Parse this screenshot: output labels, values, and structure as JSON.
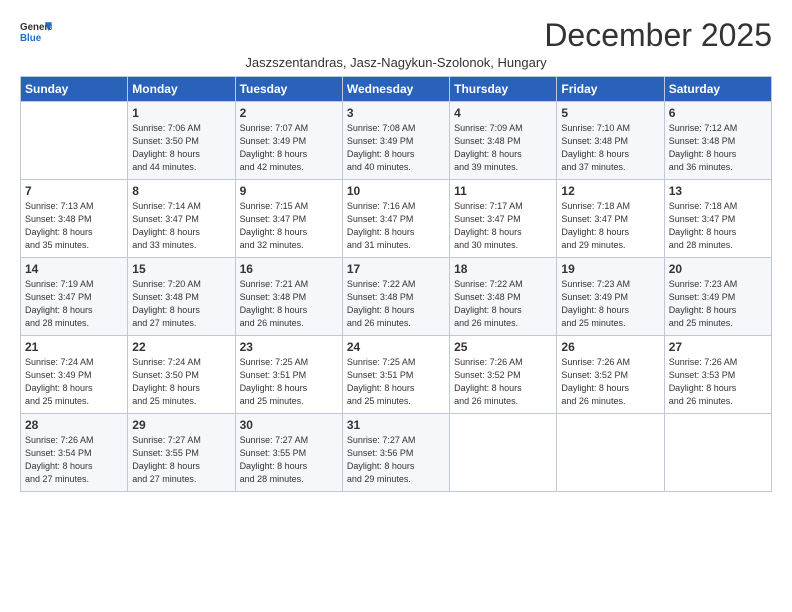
{
  "logo": {
    "line1": "General",
    "line2": "Blue"
  },
  "title": "December 2025",
  "subtitle": "Jaszszentandras, Jasz-Nagykun-Szolonok, Hungary",
  "header_days": [
    "Sunday",
    "Monday",
    "Tuesday",
    "Wednesday",
    "Thursday",
    "Friday",
    "Saturday"
  ],
  "weeks": [
    [
      {
        "num": "",
        "info": ""
      },
      {
        "num": "1",
        "info": "Sunrise: 7:06 AM\nSunset: 3:50 PM\nDaylight: 8 hours\nand 44 minutes."
      },
      {
        "num": "2",
        "info": "Sunrise: 7:07 AM\nSunset: 3:49 PM\nDaylight: 8 hours\nand 42 minutes."
      },
      {
        "num": "3",
        "info": "Sunrise: 7:08 AM\nSunset: 3:49 PM\nDaylight: 8 hours\nand 40 minutes."
      },
      {
        "num": "4",
        "info": "Sunrise: 7:09 AM\nSunset: 3:48 PM\nDaylight: 8 hours\nand 39 minutes."
      },
      {
        "num": "5",
        "info": "Sunrise: 7:10 AM\nSunset: 3:48 PM\nDaylight: 8 hours\nand 37 minutes."
      },
      {
        "num": "6",
        "info": "Sunrise: 7:12 AM\nSunset: 3:48 PM\nDaylight: 8 hours\nand 36 minutes."
      }
    ],
    [
      {
        "num": "7",
        "info": "Sunrise: 7:13 AM\nSunset: 3:48 PM\nDaylight: 8 hours\nand 35 minutes."
      },
      {
        "num": "8",
        "info": "Sunrise: 7:14 AM\nSunset: 3:47 PM\nDaylight: 8 hours\nand 33 minutes."
      },
      {
        "num": "9",
        "info": "Sunrise: 7:15 AM\nSunset: 3:47 PM\nDaylight: 8 hours\nand 32 minutes."
      },
      {
        "num": "10",
        "info": "Sunrise: 7:16 AM\nSunset: 3:47 PM\nDaylight: 8 hours\nand 31 minutes."
      },
      {
        "num": "11",
        "info": "Sunrise: 7:17 AM\nSunset: 3:47 PM\nDaylight: 8 hours\nand 30 minutes."
      },
      {
        "num": "12",
        "info": "Sunrise: 7:18 AM\nSunset: 3:47 PM\nDaylight: 8 hours\nand 29 minutes."
      },
      {
        "num": "13",
        "info": "Sunrise: 7:18 AM\nSunset: 3:47 PM\nDaylight: 8 hours\nand 28 minutes."
      }
    ],
    [
      {
        "num": "14",
        "info": "Sunrise: 7:19 AM\nSunset: 3:47 PM\nDaylight: 8 hours\nand 28 minutes."
      },
      {
        "num": "15",
        "info": "Sunrise: 7:20 AM\nSunset: 3:48 PM\nDaylight: 8 hours\nand 27 minutes."
      },
      {
        "num": "16",
        "info": "Sunrise: 7:21 AM\nSunset: 3:48 PM\nDaylight: 8 hours\nand 26 minutes."
      },
      {
        "num": "17",
        "info": "Sunrise: 7:22 AM\nSunset: 3:48 PM\nDaylight: 8 hours\nand 26 minutes."
      },
      {
        "num": "18",
        "info": "Sunrise: 7:22 AM\nSunset: 3:48 PM\nDaylight: 8 hours\nand 26 minutes."
      },
      {
        "num": "19",
        "info": "Sunrise: 7:23 AM\nSunset: 3:49 PM\nDaylight: 8 hours\nand 25 minutes."
      },
      {
        "num": "20",
        "info": "Sunrise: 7:23 AM\nSunset: 3:49 PM\nDaylight: 8 hours\nand 25 minutes."
      }
    ],
    [
      {
        "num": "21",
        "info": "Sunrise: 7:24 AM\nSunset: 3:49 PM\nDaylight: 8 hours\nand 25 minutes."
      },
      {
        "num": "22",
        "info": "Sunrise: 7:24 AM\nSunset: 3:50 PM\nDaylight: 8 hours\nand 25 minutes."
      },
      {
        "num": "23",
        "info": "Sunrise: 7:25 AM\nSunset: 3:51 PM\nDaylight: 8 hours\nand 25 minutes."
      },
      {
        "num": "24",
        "info": "Sunrise: 7:25 AM\nSunset: 3:51 PM\nDaylight: 8 hours\nand 25 minutes."
      },
      {
        "num": "25",
        "info": "Sunrise: 7:26 AM\nSunset: 3:52 PM\nDaylight: 8 hours\nand 26 minutes."
      },
      {
        "num": "26",
        "info": "Sunrise: 7:26 AM\nSunset: 3:52 PM\nDaylight: 8 hours\nand 26 minutes."
      },
      {
        "num": "27",
        "info": "Sunrise: 7:26 AM\nSunset: 3:53 PM\nDaylight: 8 hours\nand 26 minutes."
      }
    ],
    [
      {
        "num": "28",
        "info": "Sunrise: 7:26 AM\nSunset: 3:54 PM\nDaylight: 8 hours\nand 27 minutes."
      },
      {
        "num": "29",
        "info": "Sunrise: 7:27 AM\nSunset: 3:55 PM\nDaylight: 8 hours\nand 27 minutes."
      },
      {
        "num": "30",
        "info": "Sunrise: 7:27 AM\nSunset: 3:55 PM\nDaylight: 8 hours\nand 28 minutes."
      },
      {
        "num": "31",
        "info": "Sunrise: 7:27 AM\nSunset: 3:56 PM\nDaylight: 8 hours\nand 29 minutes."
      },
      {
        "num": "",
        "info": ""
      },
      {
        "num": "",
        "info": ""
      },
      {
        "num": "",
        "info": ""
      }
    ]
  ]
}
